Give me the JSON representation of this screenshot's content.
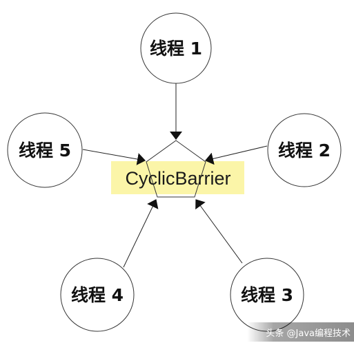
{
  "center": {
    "label": "CyclicBarrier",
    "highlight_color": "#fbf5a8",
    "outline_color": "#333333"
  },
  "threads": [
    {
      "id": "thread-1",
      "label": "线程 1"
    },
    {
      "id": "thread-2",
      "label": "线程 2"
    },
    {
      "id": "thread-3",
      "label": "线程 3"
    },
    {
      "id": "thread-4",
      "label": "线程 4"
    },
    {
      "id": "thread-5",
      "label": "线程 5"
    }
  ],
  "watermark": {
    "text": "头条 @Java编程技术"
  },
  "colors": {
    "line": "#222222",
    "circle_stroke": "#333333",
    "text": "#111111"
  }
}
